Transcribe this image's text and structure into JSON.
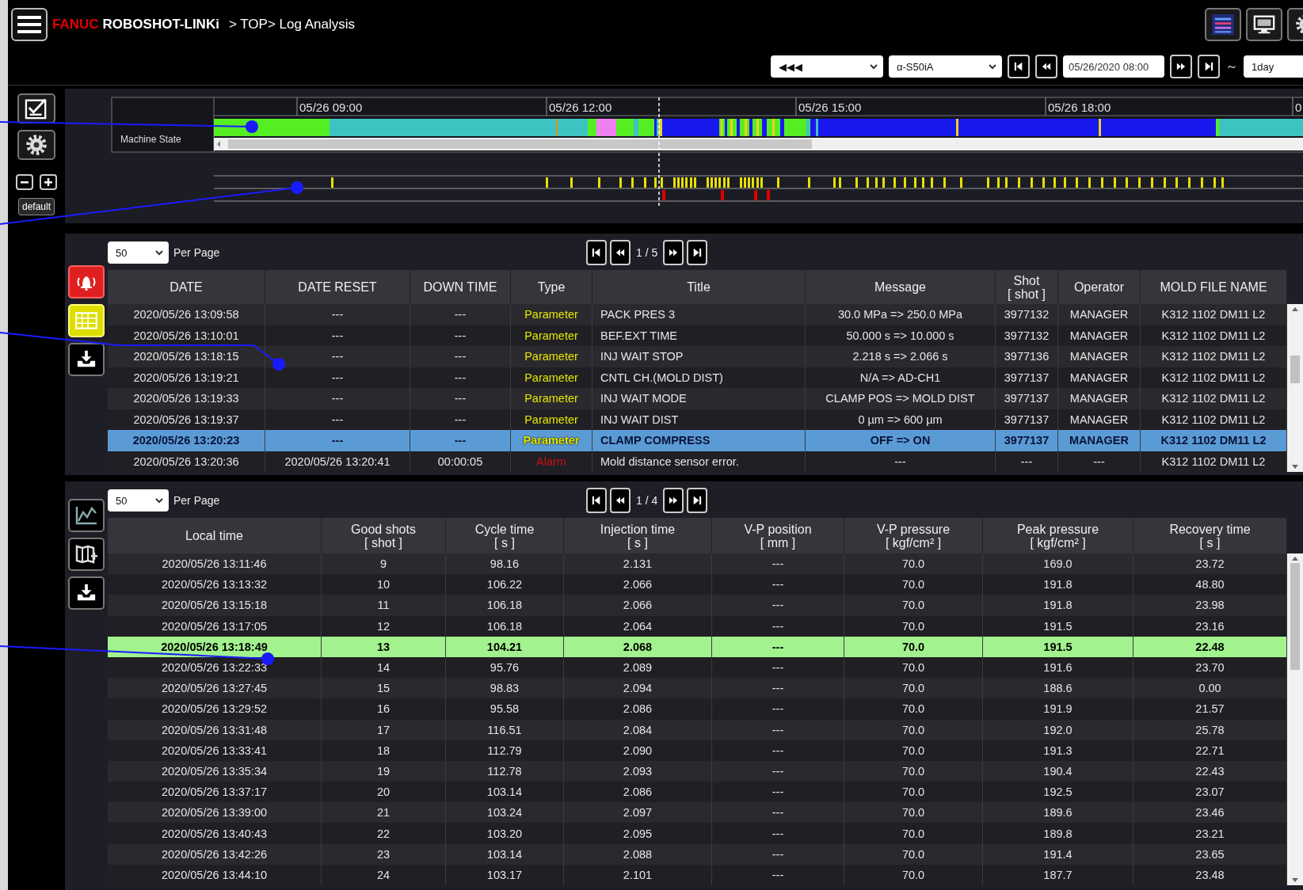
{
  "header": {
    "brand_mark": "FANUC",
    "brand": "ROBOSHOT-LINKi",
    "breadcrumb": "> TOP> Log Analysis"
  },
  "toolbar": {
    "range_select": "◀◀◀",
    "machine_select": "α-S50iA",
    "date_field": "05/26/2020 08:00",
    "range_separator": "～",
    "span_select": "1day"
  },
  "timeline": {
    "row_label": "Machine State",
    "time_labels": [
      "05/26 09:00",
      "05/26 12:00",
      "05/26 15:00",
      "05/26 18:00",
      "0"
    ]
  },
  "zoom_controls": {
    "reset_button": "default"
  },
  "event_log": {
    "per_page": "50",
    "per_page_label": "Per Page",
    "page": "1 / 5",
    "columns": [
      {
        "label": "DATE"
      },
      {
        "label": "DATE RESET"
      },
      {
        "label": "DOWN TIME"
      },
      {
        "label": "Type"
      },
      {
        "label": "Title"
      },
      {
        "label": "Message"
      },
      {
        "label": "Shot",
        "unit": "[ shot ]"
      },
      {
        "label": "Operator"
      },
      {
        "label": "MOLD FILE NAME"
      }
    ],
    "rows": [
      {
        "cells": [
          "2020/05/26 13:09:58",
          "---",
          "---",
          "Parameter",
          "PACK PRES 3",
          "30.0 MPa => 250.0 MPa",
          "3977132",
          "MANAGER",
          "K312 1102 DM11 L2"
        ],
        "kind": "parameter",
        "selected": false
      },
      {
        "cells": [
          "2020/05/26 13:10:01",
          "---",
          "---",
          "Parameter",
          "BEF.EXT TIME",
          "50.000 s => 10.000 s",
          "3977132",
          "MANAGER",
          "K312 1102 DM11 L2"
        ],
        "kind": "parameter",
        "selected": false
      },
      {
        "cells": [
          "2020/05/26 13:18:15",
          "---",
          "---",
          "Parameter",
          "INJ WAIT STOP",
          "2.218 s => 2.066 s",
          "3977136",
          "MANAGER",
          "K312 1102 DM11 L2"
        ],
        "kind": "parameter",
        "selected": false
      },
      {
        "cells": [
          "2020/05/26 13:19:21",
          "---",
          "---",
          "Parameter",
          "CNTL CH.(MOLD DIST)",
          "N/A => AD-CH1",
          "3977137",
          "MANAGER",
          "K312 1102 DM11 L2"
        ],
        "kind": "parameter",
        "selected": false
      },
      {
        "cells": [
          "2020/05/26 13:19:33",
          "---",
          "---",
          "Parameter",
          "INJ WAIT MODE",
          "CLAMP POS => MOLD DIST",
          "3977137",
          "MANAGER",
          "K312 1102 DM11 L2"
        ],
        "kind": "parameter",
        "selected": false
      },
      {
        "cells": [
          "2020/05/26 13:19:37",
          "---",
          "---",
          "Parameter",
          "INJ WAIT DIST",
          "0 µm => 600 µm",
          "3977137",
          "MANAGER",
          "K312 1102 DM11 L2"
        ],
        "kind": "parameter",
        "selected": false
      },
      {
        "cells": [
          "2020/05/26 13:20:23",
          "---",
          "---",
          "Parameter",
          "CLAMP COMPRESS",
          "OFF => ON",
          "3977137",
          "MANAGER",
          "K312 1102 DM11 L2"
        ],
        "kind": "parameter",
        "selected": true
      },
      {
        "cells": [
          "2020/05/26 13:20:36",
          "2020/05/26 13:20:41",
          "00:00:05",
          "Alarm",
          "Mold distance sensor error.",
          "---",
          "---",
          "---",
          "K312 1102 DM11 L2"
        ],
        "kind": "alarm",
        "selected": false
      }
    ]
  },
  "shot_log": {
    "per_page": "50",
    "per_page_label": "Per Page",
    "page": "1 / 4",
    "columns": [
      {
        "label": "Local time"
      },
      {
        "label": "Good shots",
        "unit": "[ shot ]"
      },
      {
        "label": "Cycle time",
        "unit": "[ s ]"
      },
      {
        "label": "Injection time",
        "unit": "[ s ]"
      },
      {
        "label": "V-P position",
        "unit": "[ mm ]"
      },
      {
        "label": "V-P pressure",
        "unit": "[ kgf/cm² ]"
      },
      {
        "label": "Peak pressure",
        "unit": "[ kgf/cm² ]"
      },
      {
        "label": "Recovery time",
        "unit": "[ s ]"
      }
    ],
    "rows": [
      {
        "cells": [
          "2020/05/26 13:11:46",
          "9",
          "98.16",
          "2.131",
          "---",
          "70.0",
          "169.0",
          "23.72"
        ],
        "selected": false
      },
      {
        "cells": [
          "2020/05/26 13:13:32",
          "10",
          "106.22",
          "2.066",
          "---",
          "70.0",
          "191.8",
          "48.80"
        ],
        "selected": false
      },
      {
        "cells": [
          "2020/05/26 13:15:18",
          "11",
          "106.18",
          "2.066",
          "---",
          "70.0",
          "191.8",
          "23.98"
        ],
        "selected": false
      },
      {
        "cells": [
          "2020/05/26 13:17:05",
          "12",
          "106.18",
          "2.064",
          "---",
          "70.0",
          "191.5",
          "23.16"
        ],
        "selected": false
      },
      {
        "cells": [
          "2020/05/26 13:18:49",
          "13",
          "104.21",
          "2.068",
          "---",
          "70.0",
          "191.5",
          "22.48"
        ],
        "selected": true
      },
      {
        "cells": [
          "2020/05/26 13:22:33",
          "14",
          "95.76",
          "2.089",
          "---",
          "70.0",
          "191.6",
          "23.70"
        ],
        "selected": false
      },
      {
        "cells": [
          "2020/05/26 13:27:45",
          "15",
          "98.83",
          "2.094",
          "---",
          "70.0",
          "188.6",
          "0.00"
        ],
        "selected": false
      },
      {
        "cells": [
          "2020/05/26 13:29:52",
          "16",
          "95.58",
          "2.086",
          "---",
          "70.0",
          "191.9",
          "21.57"
        ],
        "selected": false
      },
      {
        "cells": [
          "2020/05/26 13:31:48",
          "17",
          "116.51",
          "2.084",
          "---",
          "70.0",
          "192.0",
          "25.78"
        ],
        "selected": false
      },
      {
        "cells": [
          "2020/05/26 13:33:41",
          "18",
          "112.79",
          "2.090",
          "---",
          "70.0",
          "191.3",
          "22.71"
        ],
        "selected": false
      },
      {
        "cells": [
          "2020/05/26 13:35:34",
          "19",
          "112.78",
          "2.093",
          "---",
          "70.0",
          "190.4",
          "22.43"
        ],
        "selected": false
      },
      {
        "cells": [
          "2020/05/26 13:37:17",
          "20",
          "103.14",
          "2.086",
          "---",
          "70.0",
          "192.5",
          "23.07"
        ],
        "selected": false
      },
      {
        "cells": [
          "2020/05/26 13:39:00",
          "21",
          "103.24",
          "2.097",
          "---",
          "70.0",
          "189.6",
          "23.46"
        ],
        "selected": false
      },
      {
        "cells": [
          "2020/05/26 13:40:43",
          "22",
          "103.20",
          "2.095",
          "---",
          "70.0",
          "189.8",
          "23.21"
        ],
        "selected": false
      },
      {
        "cells": [
          "2020/05/26 13:42:26",
          "23",
          "103.14",
          "2.088",
          "---",
          "70.0",
          "191.4",
          "23.65"
        ],
        "selected": false
      },
      {
        "cells": [
          "2020/05/26 13:44:10",
          "24",
          "103.17",
          "2.101",
          "---",
          "70.0",
          "187.7",
          "23.48"
        ],
        "selected": false
      }
    ]
  }
}
